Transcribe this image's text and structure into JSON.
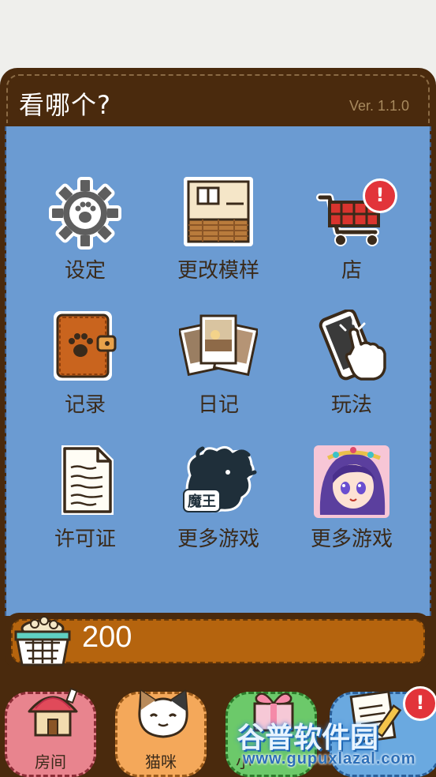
{
  "header": {
    "title": "看哪个?",
    "version": "Ver. 1.1.0"
  },
  "menu": {
    "settings": "设定",
    "change_pattern": "更改模样",
    "shop": "店",
    "records": "记录",
    "diary": "日记",
    "how_to_play": "玩法",
    "license": "许可证",
    "more_games_1": "更多游戏",
    "more_games_2": "更多游戏",
    "more_games_1_logo_text": "魔王",
    "shop_badge": "!"
  },
  "coins": {
    "value": "200"
  },
  "bottom_nav": {
    "room": "房间",
    "cats": "猫咪",
    "third": "小",
    "badge": "!"
  },
  "watermark": {
    "text": "谷普软件园",
    "url": "www.gupuxlazal.com"
  },
  "colors": {
    "panel": "#4a2a0d",
    "grid_bg": "#6b9bd2",
    "coin_bar": "#b5640e",
    "badge": "#e2343a"
  }
}
